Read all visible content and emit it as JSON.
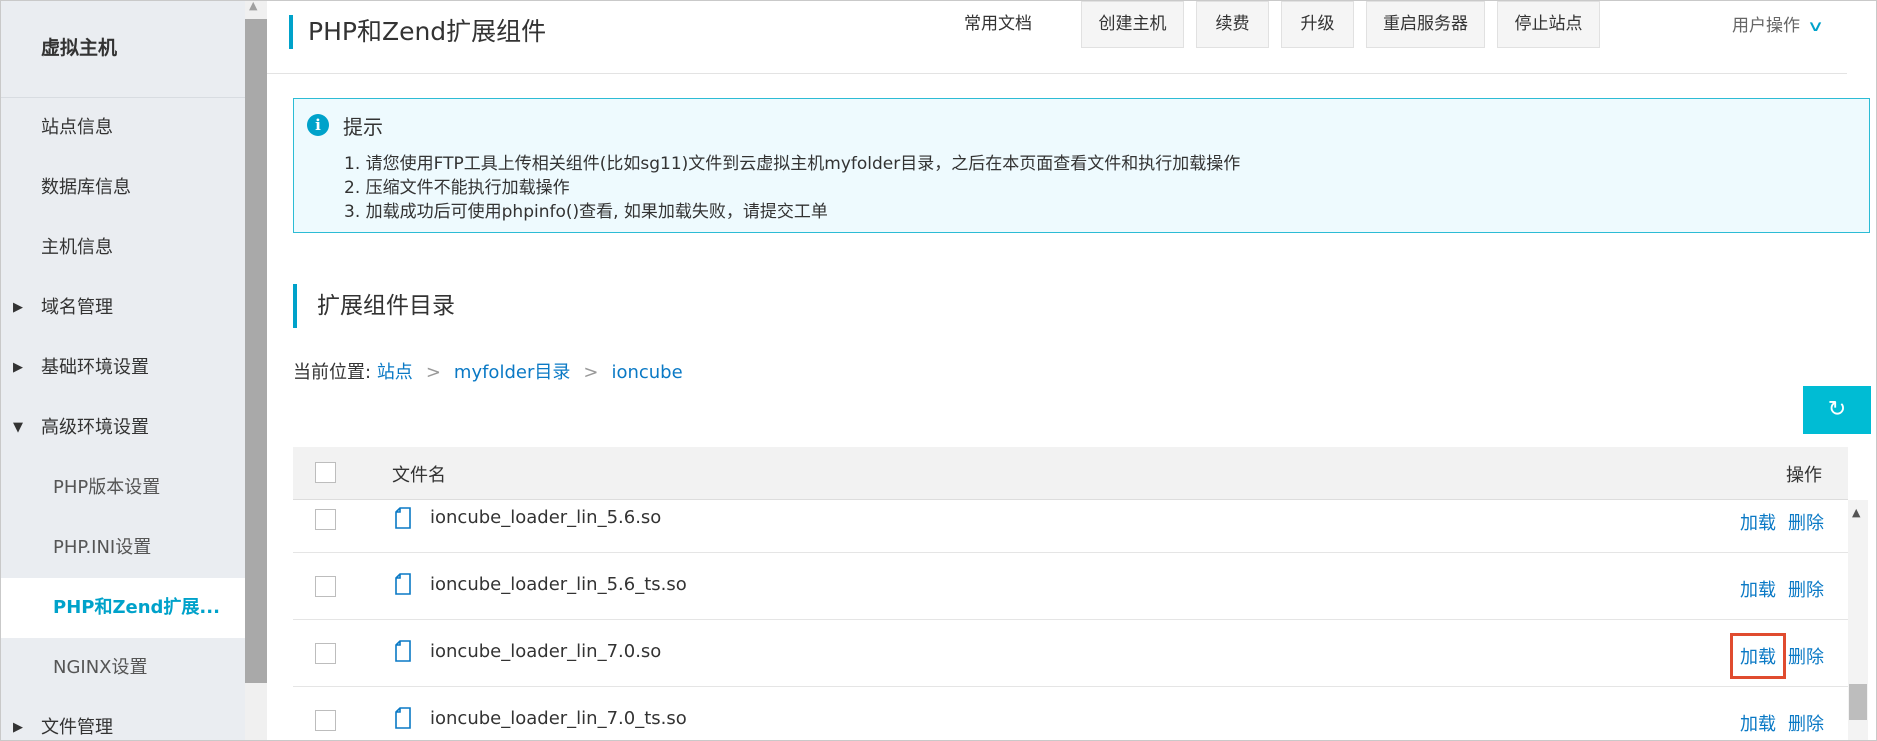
{
  "sidebar": {
    "title": "虚拟主机",
    "items": [
      {
        "label": "站点信息",
        "level": 0,
        "arrow": ""
      },
      {
        "label": "数据库信息",
        "level": 0,
        "arrow": ""
      },
      {
        "label": "主机信息",
        "level": 0,
        "arrow": ""
      },
      {
        "label": "域名管理",
        "level": 0,
        "arrow": "▶"
      },
      {
        "label": "基础环境设置",
        "level": 0,
        "arrow": "▶"
      },
      {
        "label": "高级环境设置",
        "level": 0,
        "arrow": "▼"
      },
      {
        "label": "PHP版本设置",
        "level": 1,
        "arrow": ""
      },
      {
        "label": "PHP.INI设置",
        "level": 1,
        "arrow": ""
      },
      {
        "label": "PHP和Zend扩展...",
        "level": 1,
        "arrow": "",
        "active": true
      },
      {
        "label": "NGINX设置",
        "level": 1,
        "arrow": ""
      },
      {
        "label": "文件管理",
        "level": 0,
        "arrow": "▶"
      }
    ]
  },
  "header": {
    "title": "PHP和Zend扩展组件",
    "common_docs": "常用文档",
    "buttons": [
      "创建主机",
      "续费",
      "升级",
      "重启服务器",
      "停止站点"
    ],
    "user_ops": "用户操作",
    "user_ops_icon": "chevron-down-icon"
  },
  "tip": {
    "icon": "info-icon",
    "title": "提示",
    "lines": [
      "1. 请您使用FTP工具上传相关组件(比如sg11)文件到云虚拟主机myfolder目录，之后在本页面查看文件和执行加载操作",
      "2. 压缩文件不能执行加载操作",
      "3. 加载成功后可使用phpinfo()查看, 如果加载失败，请提交工单"
    ]
  },
  "section": {
    "title": "扩展组件目录",
    "breadcrumb_prefix": "当前位置:",
    "breadcrumb": [
      "站点",
      "myfolder目录",
      "ioncube"
    ],
    "separator": ">",
    "refresh_icon": "refresh-icon",
    "refresh_glyph": "↻"
  },
  "table": {
    "headers": {
      "name": "文件名",
      "ops": "操作"
    },
    "rows": [
      {
        "name": "ioncube_loader_lin_5.6.so",
        "load": "加载",
        "delete": "删除"
      },
      {
        "name": "ioncube_loader_lin_5.6_ts.so",
        "load": "加载",
        "delete": "删除"
      },
      {
        "name": "ioncube_loader_lin_7.0.so",
        "load": "加载",
        "delete": "删除",
        "highlighted": true
      },
      {
        "name": "ioncube_loader_lin_7.0_ts.so",
        "load": "加载",
        "delete": "删除"
      }
    ]
  },
  "colors": {
    "accent": "#00a2ca",
    "link": "#0a79c5",
    "highlight_box": "#e04b2f",
    "tip_bg": "#eefafe",
    "refresh_bg": "#00bcd4"
  }
}
